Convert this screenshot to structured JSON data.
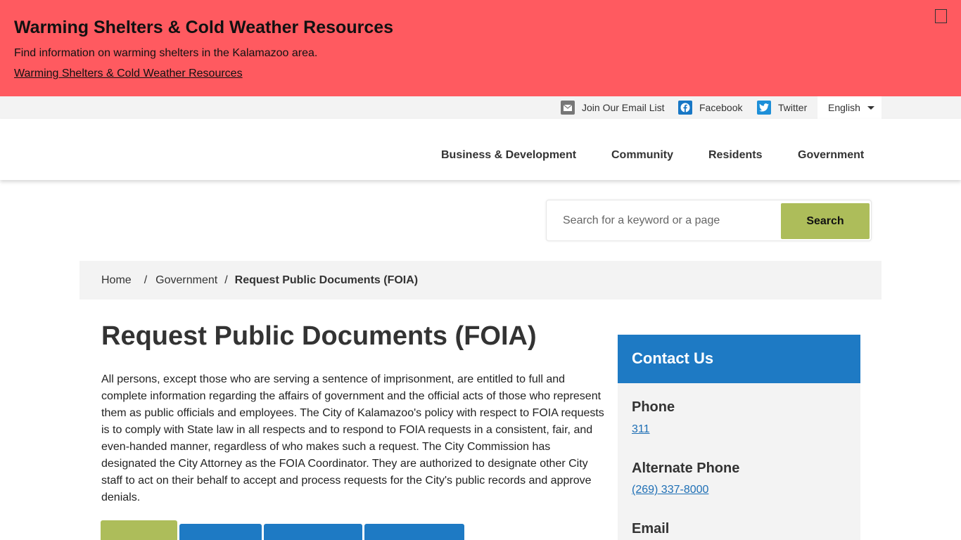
{
  "alert": {
    "title": "Warming Shelters & Cold Weather Resources",
    "text": "Find information on warming shelters in the Kalamazoo area.",
    "link": "Warming Shelters & Cold Weather Resources"
  },
  "utility": {
    "email": "Join Our Email List",
    "facebook": "Facebook",
    "twitter": "Twitter",
    "language": "English"
  },
  "nav": {
    "items": [
      "Business & Development",
      "Community",
      "Residents",
      "Government"
    ]
  },
  "search": {
    "placeholder": "Search for a keyword or a page",
    "button": "Search"
  },
  "breadcrumb": {
    "home": "Home",
    "parent": "Government",
    "current": "Request Public Documents (FOIA)",
    "separator": "/"
  },
  "main": {
    "title": "Request Public Documents (FOIA)",
    "body": "All persons, except those who are serving a sentence of imprisonment, are entitled to full and complete information regarding the affairs of government and the official acts of those who represent them as public officials and employees. The City of Kalamazoo's policy with respect to FOIA requests is to comply with State law in all respects and to respond to FOIA requests in a consistent, fair, and even-handed manner, regardless of who makes such a request. The City Commission has designated the City Attorney as the FOIA Coordinator. They are authorized to designate other City staff to act on their behalf to accept and process requests for the City's public records and approve denials."
  },
  "sidebar": {
    "title": "Contact Us",
    "phone_label": "Phone",
    "phone": "311",
    "alt_phone_label": "Alternate Phone",
    "alt_phone": "(269) 337-8000",
    "email_label": "Email"
  },
  "colors": {
    "alert_bg": "#ff5a60",
    "accent_blue": "#1e7ac4",
    "accent_green": "#adbd5a"
  },
  "icons": [
    "mail-icon",
    "facebook-icon",
    "twitter-icon",
    "chevron-down-icon",
    "close-icon"
  ]
}
